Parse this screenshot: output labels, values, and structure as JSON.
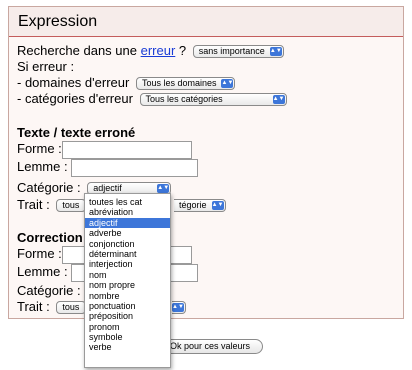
{
  "header": {
    "title": "Expression"
  },
  "search": {
    "prefix": "Recherche dans une",
    "link": "erreur",
    "suffix": "?",
    "importance_value": "sans importance"
  },
  "if_error": "Si erreur :",
  "domains": {
    "label": "- domaines d'erreur",
    "value": "Tous les domaines"
  },
  "categories": {
    "label": "- catégories d'erreur",
    "value": "Tous les catégories"
  },
  "texte": {
    "heading": "Texte / texte erroné",
    "forme_label": "Forme :",
    "lemme_label": "Lemme :",
    "categorie_label": "Catégorie :",
    "categorie_value": "adjectif",
    "trait_label": "Trait :",
    "trait_value_left": "tous",
    "trait_value_right": "tégorie"
  },
  "correction": {
    "heading": "Correction",
    "forme_label": "Forme :",
    "lemme_label": "Lemme :",
    "categorie_label": "Catégorie :",
    "trait_label": "Trait :",
    "trait_value_left": "tous"
  },
  "ok_button": "Ok pour ces valeurs",
  "dropdown_options": [
    "toutes les cat",
    "abréviation",
    "adjectif",
    "adverbe",
    "conjonction",
    "déterminant",
    "interjection",
    "nom",
    "nom propre",
    "nombre",
    "ponctuation",
    "préposition",
    "pronom",
    "symbole",
    "verbe"
  ],
  "dropdown_selected": "adjectif"
}
